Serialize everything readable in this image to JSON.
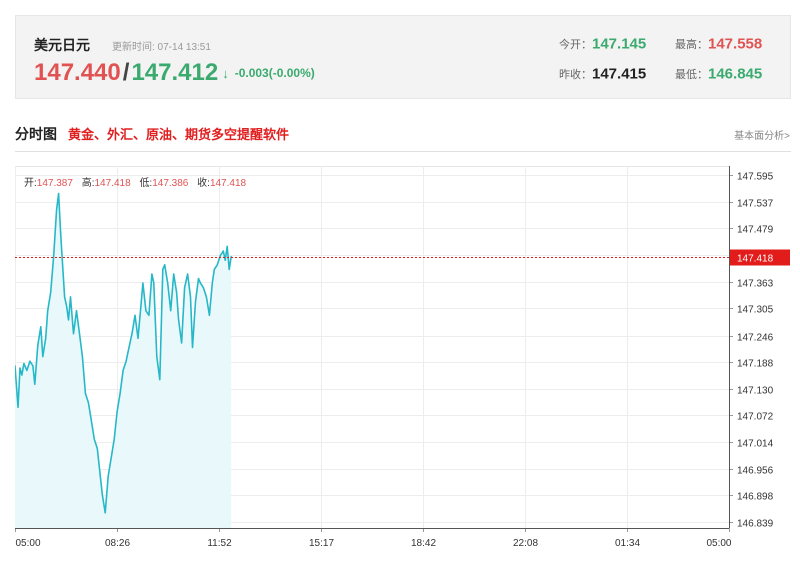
{
  "quote": {
    "title": "美元日元",
    "update_time": "更新时间: 07-14 13:51",
    "price_main": "147.440",
    "price_alt": "147.412",
    "arrow": "↓",
    "change": "-0.003(-0.00%)",
    "open_label": "今开：",
    "open_value": "147.145",
    "high_label": "最高：",
    "high_value": "147.558",
    "prev_close_label": "昨收：",
    "prev_close_value": "147.415",
    "low_label": "最低：",
    "low_value": "146.845"
  },
  "section": {
    "title": "分时图",
    "promo_link": "黄金、外汇、原油、期货多空提醒软件",
    "fundamentals_link": "基本面分析>"
  },
  "ohlc": {
    "open_label": "开:",
    "open_value": "147.387",
    "high_label": "高:",
    "high_value": "147.418",
    "low_label": "低:",
    "low_value": "147.386",
    "close_label": "收:",
    "close_value": "147.418"
  },
  "colors": {
    "up": "#e15353",
    "down": "#3aaa6e",
    "line": "#26b8c8",
    "area": "#e9f8fb",
    "current_marker": "#e21b1b"
  },
  "chart_data": {
    "type": "area",
    "title": "",
    "xlabel": "",
    "ylabel": "",
    "x_ticks": [
      "05:00",
      "08:26",
      "11:52",
      "15:17",
      "18:42",
      "22:08",
      "01:34",
      "05:00"
    ],
    "y_ticks": [
      147.595,
      147.537,
      147.479,
      147.421,
      147.363,
      147.305,
      147.246,
      147.188,
      147.13,
      147.072,
      147.014,
      146.956,
      146.898,
      146.839
    ],
    "ylim": [
      146.827,
      147.615
    ],
    "x_span_minutes": 1440,
    "current_value": 147.418,
    "current_label": "147.418",
    "grid": true,
    "series": [
      {
        "x_minutes": [
          0,
          6,
          10,
          14,
          18,
          24,
          30,
          36,
          40,
          46,
          52,
          56,
          62,
          66,
          72,
          78,
          84,
          88,
          92,
          96,
          100,
          104,
          108,
          112,
          118,
          124,
          130,
          136,
          142,
          148,
          154,
          160,
          166,
          170,
          176,
          182,
          188,
          194,
          200,
          206,
          212,
          218,
          224,
          230,
          236,
          242,
          248,
          254,
          258,
          264,
          270,
          276,
          280,
          286,
          292,
          298,
          302,
          308,
          314,
          320,
          326,
          330,
          336,
          342,
          348,
          354,
          358,
          364,
          370,
          374,
          380,
          386,
          392,
          398,
          402,
          408,
          414,
          420,
          424,
          428,
          432,
          436
        ],
        "values": [
          147.18,
          147.09,
          147.175,
          147.16,
          147.185,
          147.17,
          147.19,
          147.18,
          147.14,
          147.225,
          147.265,
          147.2,
          147.24,
          147.3,
          147.34,
          147.42,
          147.52,
          147.555,
          147.47,
          147.4,
          147.33,
          147.31,
          147.28,
          147.33,
          147.25,
          147.3,
          147.25,
          147.2,
          147.12,
          147.1,
          147.06,
          147.02,
          147.0,
          146.96,
          146.9,
          146.86,
          146.94,
          146.98,
          147.02,
          147.08,
          147.12,
          147.17,
          147.19,
          147.22,
          147.25,
          147.29,
          147.24,
          147.31,
          147.36,
          147.3,
          147.29,
          147.38,
          147.36,
          147.2,
          147.15,
          147.39,
          147.4,
          147.36,
          147.3,
          147.38,
          147.34,
          147.28,
          147.23,
          147.35,
          147.38,
          147.33,
          147.22,
          147.32,
          147.37,
          147.36,
          147.35,
          147.33,
          147.29,
          147.36,
          147.39,
          147.4,
          147.42,
          147.43,
          147.41,
          147.44,
          147.39,
          147.418
        ]
      }
    ]
  }
}
